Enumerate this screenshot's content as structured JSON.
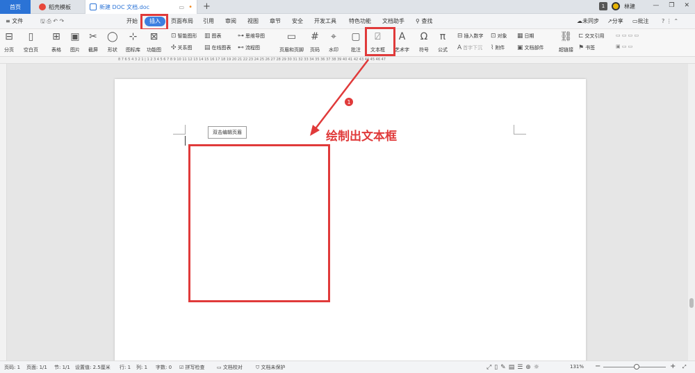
{
  "tabs": {
    "home": "首页",
    "templates": "稻壳模板",
    "document": "新建 DOC 文档.doc",
    "plus": "+"
  },
  "user": {
    "badge": "1",
    "name": "林建"
  },
  "window": {
    "minimize": "—",
    "restore": "❐",
    "close": "✕"
  },
  "menubar": {
    "file": "≡ 文件",
    "items": [
      "开始",
      "插入",
      "页面布局",
      "引用",
      "审阅",
      "视图",
      "章节",
      "安全",
      "开发工具",
      "特色功能",
      "文档助手"
    ],
    "search": "查找",
    "sync": "未同步",
    "share": "分享",
    "comment": "批注"
  },
  "ribbon": {
    "page_break": "分页",
    "blank_page": "空白页",
    "table": "表格",
    "picture": "图片",
    "screenshot": "截屏",
    "shape": "形状",
    "icon_lib": "图标库",
    "func_chart": "功能图",
    "smart_shape": "智能图形",
    "chart": "图表",
    "mind_map": "思维导图",
    "relation": "关系图",
    "online_chart": "在线图表",
    "flowchart": "流程图",
    "header_footer": "页眉和页脚",
    "page_number": "页码",
    "watermark": "水印",
    "comment": "批注",
    "textbox": "文本框",
    "art_text": "艺术字",
    "symbol": "符号",
    "formula": "公式",
    "insert_number": "插入数字",
    "object": "对象",
    "date": "日期",
    "first_drop": "首字下沉",
    "attachment": "附件",
    "doc_parts": "文档部件",
    "hyperlink": "超链接",
    "cross_ref": "交叉引用",
    "bookmark": "书签"
  },
  "ruler": {
    "ticks": "8 7 6 5 4 3 2 1 | 1 2 3 4 5 6 7 8 9 10 11 12 13 14 15 16 17 18 19 20 21 22 23 24 25 26 27 28 29 30 31 32 33 34 35 36 37 38 39 40 41 42 43 44 45 46 47"
  },
  "page": {
    "header_hint": "双击编辑页眉",
    "annotation": "绘制出文本框",
    "step_marker": "1"
  },
  "status": {
    "page_code": "页码: 1",
    "page_count": "页面: 1/1",
    "section": "节: 1/1",
    "setting": "设置值: 2.5厘米",
    "row": "行: 1",
    "col": "列: 1",
    "word_count": "字数: 0",
    "spell": "拼写检查",
    "proof": "文档校对",
    "protect": "文档未保护",
    "zoom": "131%"
  },
  "colors": {
    "accent": "#2b73d6",
    "annotation": "#e03a3a"
  }
}
